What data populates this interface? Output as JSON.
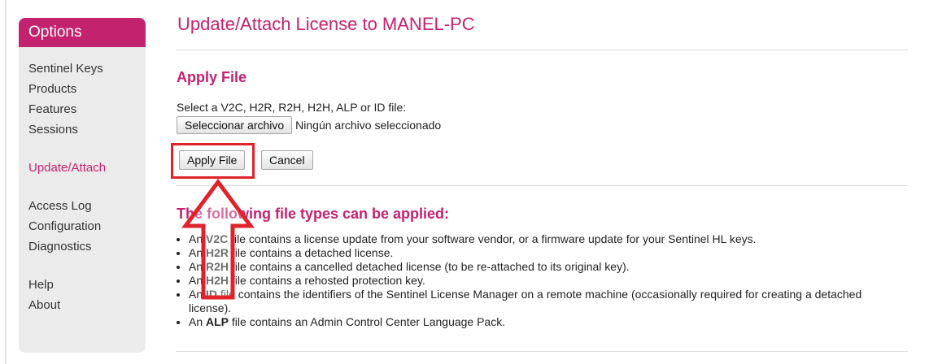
{
  "sidebar": {
    "title": "Options",
    "items": [
      {
        "label": "Sentinel Keys"
      },
      {
        "label": "Products"
      },
      {
        "label": "Features"
      },
      {
        "label": "Sessions"
      },
      {
        "label": "Update/Attach",
        "active": true
      },
      {
        "label": "Access Log"
      },
      {
        "label": "Configuration"
      },
      {
        "label": "Diagnostics"
      },
      {
        "label": "Help"
      },
      {
        "label": "About"
      }
    ]
  },
  "main": {
    "title": "Update/Attach License to MANEL-PC",
    "apply_heading": "Apply File",
    "select_label": "Select a V2C, H2R, R2H, H2H, ALP or ID file:",
    "choose_button": "Seleccionar archivo",
    "file_status": "Ningún archivo seleccionado",
    "apply_button": "Apply File",
    "cancel_button": "Cancel",
    "types_heading": "The following file types can be applied:",
    "file_types": [
      {
        "pre": "An ",
        "ext": "V2C",
        "post": " file contains a license update from your software vendor, or a firmware update for your Sentinel HL keys."
      },
      {
        "pre": "An ",
        "ext": "H2R",
        "post": " file contains a detached license."
      },
      {
        "pre": "An ",
        "ext": "R2H",
        "post": " file contains a cancelled detached license (to be re-attached to its original key)."
      },
      {
        "pre": "An ",
        "ext": "H2H",
        "post": " file contains a rehosted protection key."
      },
      {
        "pre": "An ",
        "ext": "ID",
        "post": " file contains the identifiers of the Sentinel License Manager on a remote machine (occasionally required for creating a detached license)."
      },
      {
        "pre": "An ",
        "ext": "ALP",
        "post": " file contains an Admin Control Center Language Pack."
      }
    ]
  },
  "colors": {
    "accent": "#c3226e",
    "highlight": "#e0232a"
  },
  "icons": {
    "annotation": "up-arrow-icon"
  }
}
